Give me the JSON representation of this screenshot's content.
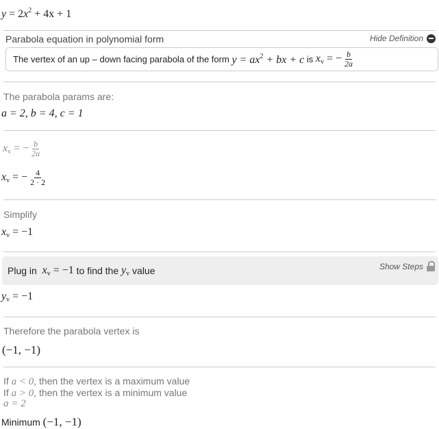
{
  "title_equation": {
    "lhs": "y",
    "a": "2",
    "var": "x",
    "exp": "2",
    "rest": "+ 4x + 1"
  },
  "definition": {
    "header": "Parabola equation in polynomial form",
    "toggle_label": "Hide Definition",
    "toggle_icon": "minus-circle-icon",
    "text_before": "The vertex of an up – down facing parabola of the form",
    "form": "y = ax",
    "form_exp": "2",
    "form_rest": "+ bx + c",
    "is": "is",
    "xv": "x",
    "xv_sub": "v",
    "eq": "= −",
    "num": "b",
    "den": "2a"
  },
  "params": {
    "label": "The parabola params are:",
    "values": "a = 2, b = 4, c = 1"
  },
  "step1": {
    "xv": "x",
    "sub": "v",
    "eq": "= −",
    "num": "b",
    "den": "2a",
    "num2": "4",
    "den2": "2 · 2"
  },
  "simplify": {
    "label": "Simplify",
    "result": "= −1"
  },
  "plug": {
    "before": "Plug in",
    "xv": "x",
    "sub": "v",
    "eq": "= −1",
    "after": "to find the",
    "yv": "y",
    "yv_sub": "v",
    "after2": "value",
    "show_steps": "Show Steps",
    "lock_icon": "lock-icon"
  },
  "yv_result": {
    "yv": "y",
    "sub": "v",
    "eq": "= −1"
  },
  "vertex": {
    "label": "Therefore the parabola vertex is",
    "value": "(−1, −1)"
  },
  "rule": {
    "line1_a": "If",
    "line1_m": "a < 0,",
    "line1_b": "then the vertex is a maximum value",
    "line2_a": "If",
    "line2_m": "a > 0,",
    "line2_b": "then the vertex is a minimum value",
    "a_value": "a = 2",
    "min_label": "Minimum",
    "min_value": "(−1, −1)"
  }
}
